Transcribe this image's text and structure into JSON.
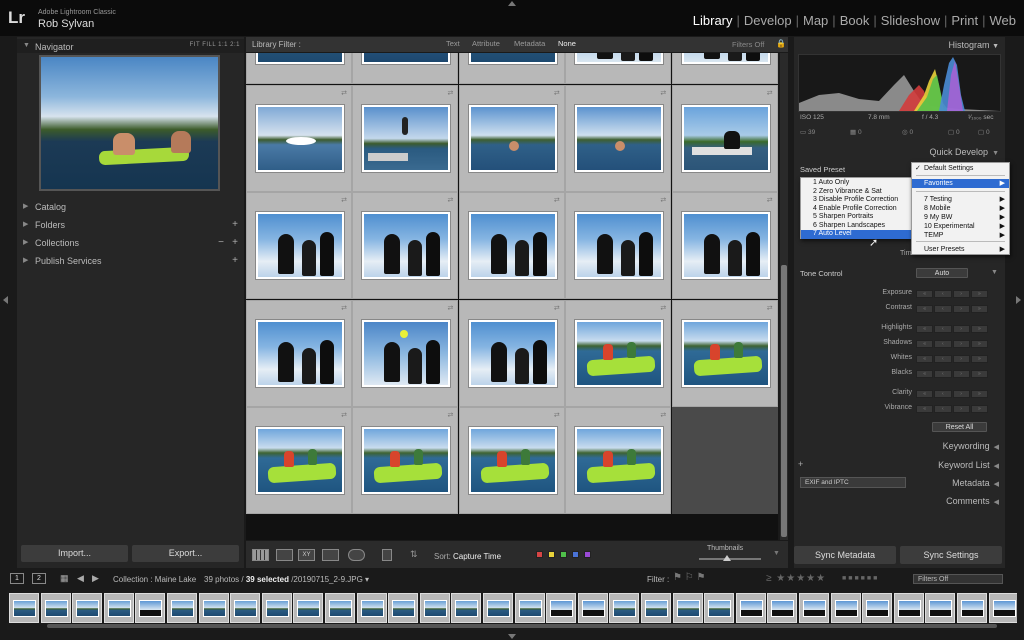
{
  "app": {
    "logo": "Lr",
    "app_name": "Adobe Lightroom Classic",
    "user_name": "Rob Sylvan"
  },
  "modules": [
    {
      "label": "Library",
      "active": true
    },
    {
      "label": "Develop",
      "active": false
    },
    {
      "label": "Map",
      "active": false
    },
    {
      "label": "Book",
      "active": false
    },
    {
      "label": "Slideshow",
      "active": false
    },
    {
      "label": "Print",
      "active": false
    },
    {
      "label": "Web",
      "active": false
    }
  ],
  "left_panel": {
    "navigator_title": "Navigator",
    "zoom_options": "FIT  FILL  1:1  2:1",
    "sections": [
      {
        "label": "Catalog",
        "plus": false,
        "minus": false
      },
      {
        "label": "Folders",
        "plus": true,
        "minus": false
      },
      {
        "label": "Collections",
        "plus": true,
        "minus": true
      },
      {
        "label": "Publish Services",
        "plus": true,
        "minus": false
      }
    ],
    "import_label": "Import...",
    "export_label": "Export..."
  },
  "filter_bar": {
    "title": "Library Filter :",
    "options": [
      {
        "label": "Text",
        "selected": false
      },
      {
        "label": "Attribute",
        "selected": false
      },
      {
        "label": "Metadata",
        "selected": false
      },
      {
        "label": "None",
        "selected": true
      }
    ],
    "filters_off": "Filters Off"
  },
  "grid": {
    "rows": [
      [
        "lake-raft",
        "lake-dock",
        "lake-raft",
        "dogs",
        "dogs"
      ],
      [
        "lake-splash",
        "dock-jump",
        "lake-swim",
        "lake-swim",
        "dock-dog"
      ],
      [
        "dogs-sky",
        "dogs-sky",
        "dogs-sky",
        "dogs-sky",
        "dogs-sky"
      ],
      [
        "dogs-sky",
        "dogs-ball",
        "dogs-sky",
        "kids-raft",
        "kids-raft"
      ],
      [
        "kids-raft",
        "kids-raft",
        "kids-raft",
        "kids-raft",
        null
      ]
    ]
  },
  "toolbar": {
    "sort_label": "Sort:",
    "sort_value": "Capture Time",
    "color_labels": [
      "#d64545",
      "#e8d23a",
      "#4fbf4a",
      "#4a73d6",
      "#9a4ad6"
    ],
    "thumbnails_label": "Thumbnails",
    "thumbnail_size": 0.45
  },
  "right_panel": {
    "histogram_title": "Histogram",
    "hist_info": {
      "iso": "ISO 125",
      "focal": "7.8 mm",
      "aperture": "f / 4.3",
      "shutter": "¹⁄₁₀₀₀ sec"
    },
    "hist_counts": {
      "photos": "39",
      "a": "0",
      "b": "0",
      "c": "0",
      "d": "0"
    },
    "quick_develop": "Quick Develop",
    "saved_preset_label": "Saved Preset",
    "tone_control_label": "Tone Control",
    "auto_label": "Auto",
    "timer_label": "Tim",
    "tone_rows": [
      "Exposure",
      "Contrast",
      "Highlights",
      "Shadows",
      "Whites",
      "Blacks",
      "Clarity",
      "Vibrance"
    ],
    "reset_all": "Reset All",
    "keywording": "Keywording",
    "keyword_list": "Keyword List",
    "metadata": "Metadata",
    "exif_value": "EXIF and IPTC",
    "comments": "Comments",
    "sync_metadata": "Sync Metadata",
    "sync_settings": "Sync Settings"
  },
  "preset_menu": {
    "items": [
      "1 Auto Only",
      "2 Zero Vibrance & Sat",
      "3 Disable Profile Correction",
      "4 Enable Profile Correction",
      "5 Sharpen Portraits",
      "6 Sharpen Landscapes",
      "7 Auto Level"
    ],
    "highlighted": "7 Auto Level"
  },
  "preset_submenu": {
    "items": [
      {
        "label": "Default Settings",
        "checked": true,
        "submenu": false,
        "highlight": false
      },
      {
        "label": "Favorites",
        "checked": false,
        "submenu": true,
        "highlight": true
      },
      {
        "label": "7 Testing",
        "checked": false,
        "submenu": true,
        "highlight": false
      },
      {
        "label": "8 Mobile",
        "checked": false,
        "submenu": true,
        "highlight": false
      },
      {
        "label": "9 My BW",
        "checked": false,
        "submenu": true,
        "highlight": false
      },
      {
        "label": "10 Experimental",
        "checked": false,
        "submenu": true,
        "highlight": false
      },
      {
        "label": "TEMP",
        "checked": false,
        "submenu": true,
        "highlight": false
      },
      {
        "label": "User Presets",
        "checked": false,
        "submenu": true,
        "highlight": false
      }
    ]
  },
  "filmstrip": {
    "page1": "1",
    "page2": "2",
    "collection": "Collection : Maine Lake",
    "count_prefix": "39 photos /",
    "count_selected": "39 selected",
    "count_file": "/20190715_2-9.JPG",
    "filter_label": "Filter :",
    "stars": "≥ ★★★★★",
    "filters_off": "Filters Off",
    "thumbs": [
      "lake",
      "lake",
      "lake",
      "lake",
      "dogs",
      "lake",
      "lake",
      "lake",
      "lake",
      "lake",
      "lake",
      "lake",
      "lake",
      "lake",
      "lake",
      "lake",
      "lake",
      "dogs",
      "dogs",
      "lake",
      "lake",
      "lake",
      "lake",
      "dogs",
      "dogs",
      "dogs",
      "dogs",
      "dogs",
      "dogs",
      "dogs",
      "dogs",
      "dogs"
    ]
  }
}
